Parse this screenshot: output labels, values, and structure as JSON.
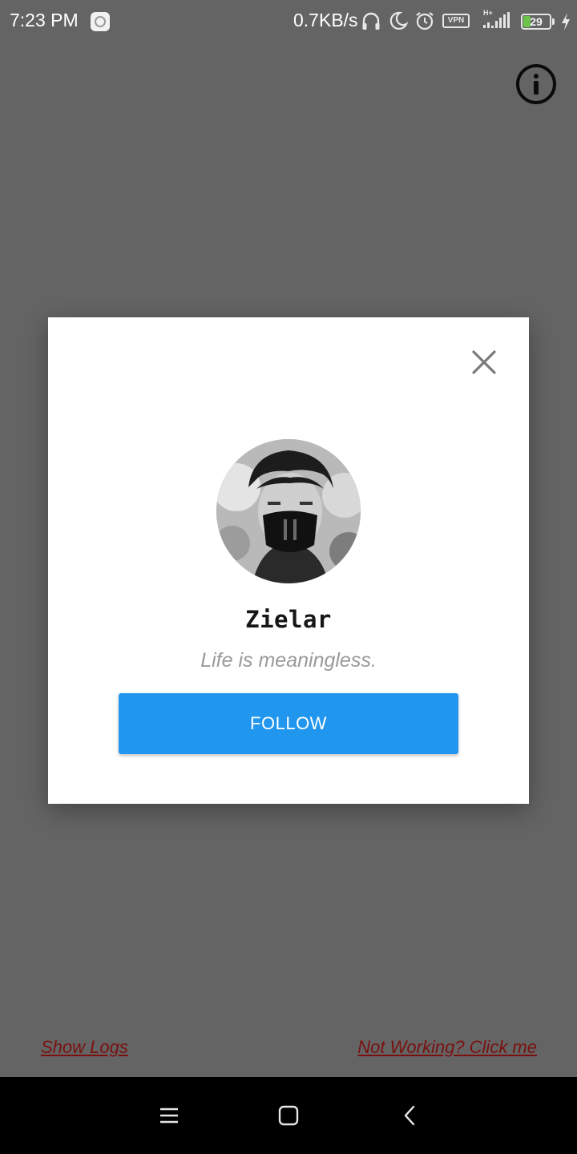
{
  "status_bar": {
    "time": "7:23 PM",
    "network_speed": "0.7KB/s",
    "vpn_label": "VPN",
    "network_type": "H+",
    "battery_level": "29",
    "battery_fraction": 0.29,
    "icons": [
      "app-notification-icon",
      "headphones-icon",
      "moon-icon",
      "alarm-icon",
      "vpn-icon",
      "signal-icon",
      "battery-icon",
      "charging-icon"
    ]
  },
  "info_button": {
    "icon": "info-icon"
  },
  "profile_dialog": {
    "close_icon": "close-icon",
    "display_name": "Zielar",
    "bio": "Life is meaningless.",
    "follow_label": "FOLLOW",
    "follow_color": "#2196ee"
  },
  "links": {
    "show_logs": "Show Logs",
    "not_working": "Not Working? Click me"
  },
  "nav_bar": {
    "icons": [
      "menu-icon",
      "home-square-icon",
      "back-icon"
    ]
  }
}
